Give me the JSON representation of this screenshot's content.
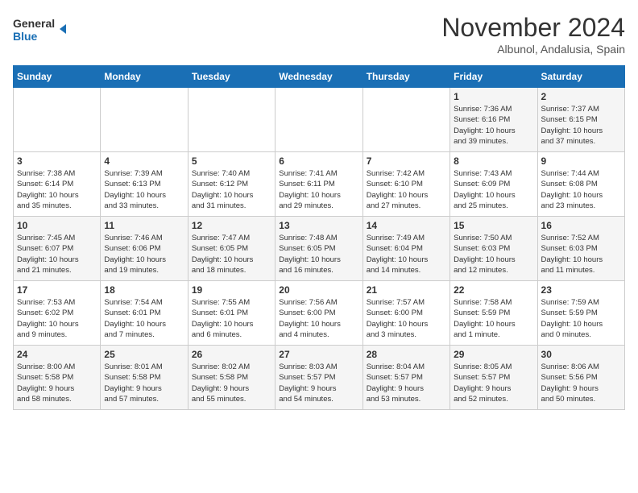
{
  "header": {
    "logo_line1": "General",
    "logo_line2": "Blue",
    "month": "November 2024",
    "location": "Albunol, Andalusia, Spain"
  },
  "weekdays": [
    "Sunday",
    "Monday",
    "Tuesday",
    "Wednesday",
    "Thursday",
    "Friday",
    "Saturday"
  ],
  "weeks": [
    [
      {
        "day": "",
        "info": ""
      },
      {
        "day": "",
        "info": ""
      },
      {
        "day": "",
        "info": ""
      },
      {
        "day": "",
        "info": ""
      },
      {
        "day": "",
        "info": ""
      },
      {
        "day": "1",
        "info": "Sunrise: 7:36 AM\nSunset: 6:16 PM\nDaylight: 10 hours\nand 39 minutes."
      },
      {
        "day": "2",
        "info": "Sunrise: 7:37 AM\nSunset: 6:15 PM\nDaylight: 10 hours\nand 37 minutes."
      }
    ],
    [
      {
        "day": "3",
        "info": "Sunrise: 7:38 AM\nSunset: 6:14 PM\nDaylight: 10 hours\nand 35 minutes."
      },
      {
        "day": "4",
        "info": "Sunrise: 7:39 AM\nSunset: 6:13 PM\nDaylight: 10 hours\nand 33 minutes."
      },
      {
        "day": "5",
        "info": "Sunrise: 7:40 AM\nSunset: 6:12 PM\nDaylight: 10 hours\nand 31 minutes."
      },
      {
        "day": "6",
        "info": "Sunrise: 7:41 AM\nSunset: 6:11 PM\nDaylight: 10 hours\nand 29 minutes."
      },
      {
        "day": "7",
        "info": "Sunrise: 7:42 AM\nSunset: 6:10 PM\nDaylight: 10 hours\nand 27 minutes."
      },
      {
        "day": "8",
        "info": "Sunrise: 7:43 AM\nSunset: 6:09 PM\nDaylight: 10 hours\nand 25 minutes."
      },
      {
        "day": "9",
        "info": "Sunrise: 7:44 AM\nSunset: 6:08 PM\nDaylight: 10 hours\nand 23 minutes."
      }
    ],
    [
      {
        "day": "10",
        "info": "Sunrise: 7:45 AM\nSunset: 6:07 PM\nDaylight: 10 hours\nand 21 minutes."
      },
      {
        "day": "11",
        "info": "Sunrise: 7:46 AM\nSunset: 6:06 PM\nDaylight: 10 hours\nand 19 minutes."
      },
      {
        "day": "12",
        "info": "Sunrise: 7:47 AM\nSunset: 6:05 PM\nDaylight: 10 hours\nand 18 minutes."
      },
      {
        "day": "13",
        "info": "Sunrise: 7:48 AM\nSunset: 6:05 PM\nDaylight: 10 hours\nand 16 minutes."
      },
      {
        "day": "14",
        "info": "Sunrise: 7:49 AM\nSunset: 6:04 PM\nDaylight: 10 hours\nand 14 minutes."
      },
      {
        "day": "15",
        "info": "Sunrise: 7:50 AM\nSunset: 6:03 PM\nDaylight: 10 hours\nand 12 minutes."
      },
      {
        "day": "16",
        "info": "Sunrise: 7:52 AM\nSunset: 6:03 PM\nDaylight: 10 hours\nand 11 minutes."
      }
    ],
    [
      {
        "day": "17",
        "info": "Sunrise: 7:53 AM\nSunset: 6:02 PM\nDaylight: 10 hours\nand 9 minutes."
      },
      {
        "day": "18",
        "info": "Sunrise: 7:54 AM\nSunset: 6:01 PM\nDaylight: 10 hours\nand 7 minutes."
      },
      {
        "day": "19",
        "info": "Sunrise: 7:55 AM\nSunset: 6:01 PM\nDaylight: 10 hours\nand 6 minutes."
      },
      {
        "day": "20",
        "info": "Sunrise: 7:56 AM\nSunset: 6:00 PM\nDaylight: 10 hours\nand 4 minutes."
      },
      {
        "day": "21",
        "info": "Sunrise: 7:57 AM\nSunset: 6:00 PM\nDaylight: 10 hours\nand 3 minutes."
      },
      {
        "day": "22",
        "info": "Sunrise: 7:58 AM\nSunset: 5:59 PM\nDaylight: 10 hours\nand 1 minute."
      },
      {
        "day": "23",
        "info": "Sunrise: 7:59 AM\nSunset: 5:59 PM\nDaylight: 10 hours\nand 0 minutes."
      }
    ],
    [
      {
        "day": "24",
        "info": "Sunrise: 8:00 AM\nSunset: 5:58 PM\nDaylight: 9 hours\nand 58 minutes."
      },
      {
        "day": "25",
        "info": "Sunrise: 8:01 AM\nSunset: 5:58 PM\nDaylight: 9 hours\nand 57 minutes."
      },
      {
        "day": "26",
        "info": "Sunrise: 8:02 AM\nSunset: 5:58 PM\nDaylight: 9 hours\nand 55 minutes."
      },
      {
        "day": "27",
        "info": "Sunrise: 8:03 AM\nSunset: 5:57 PM\nDaylight: 9 hours\nand 54 minutes."
      },
      {
        "day": "28",
        "info": "Sunrise: 8:04 AM\nSunset: 5:57 PM\nDaylight: 9 hours\nand 53 minutes."
      },
      {
        "day": "29",
        "info": "Sunrise: 8:05 AM\nSunset: 5:57 PM\nDaylight: 9 hours\nand 52 minutes."
      },
      {
        "day": "30",
        "info": "Sunrise: 8:06 AM\nSunset: 5:56 PM\nDaylight: 9 hours\nand 50 minutes."
      }
    ]
  ]
}
